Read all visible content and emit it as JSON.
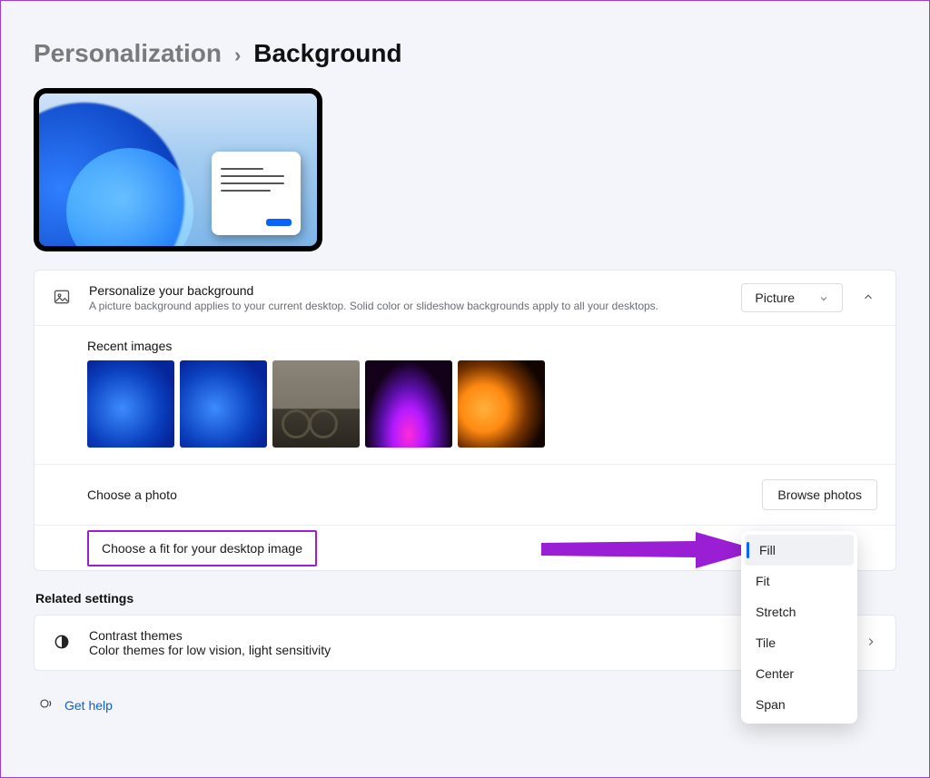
{
  "breadcrumb": {
    "parent": "Personalization",
    "separator": "›",
    "current": "Background"
  },
  "personalize": {
    "title": "Personalize your background",
    "description": "A picture background applies to your current desktop. Solid color or slideshow backgrounds apply to all your desktops.",
    "dropdown_value": "Picture"
  },
  "recent": {
    "label": "Recent images"
  },
  "choose_photo": {
    "label": "Choose a photo",
    "button": "Browse photos"
  },
  "fit": {
    "label": "Choose a fit for your desktop image",
    "options": [
      "Fill",
      "Fit",
      "Stretch",
      "Tile",
      "Center",
      "Span"
    ],
    "selected": "Fill"
  },
  "related": {
    "heading": "Related settings",
    "contrast": {
      "title": "Contrast themes",
      "desc": "Color themes for low vision, light sensitivity"
    }
  },
  "help": {
    "label": "Get help"
  }
}
